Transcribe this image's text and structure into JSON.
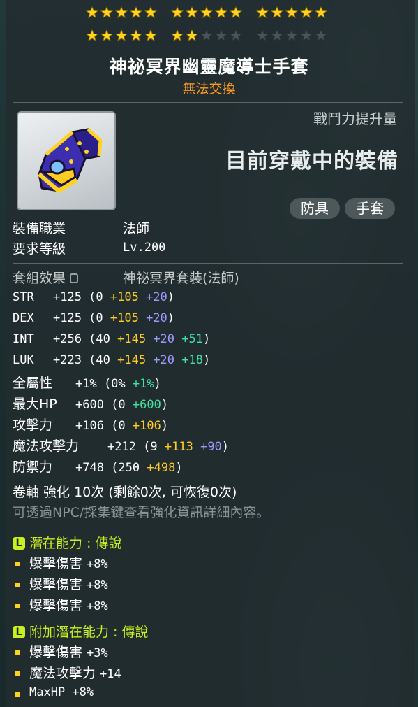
{
  "stars": {
    "row1": [
      5,
      5,
      5
    ],
    "row2": [
      5,
      2,
      0
    ],
    "filled_color": "#ffd21e",
    "empty_color": "#4a5355"
  },
  "item": {
    "name": "神祕冥界幽靈魔導士手套",
    "trade": "無法交換"
  },
  "compare": {
    "fight_label": "戰鬥力提升量",
    "wearing": "目前穿戴中的裝備",
    "tags": [
      "防具",
      "手套"
    ]
  },
  "req": {
    "job_label": "裝備職業",
    "job_value": "法師",
    "level_label": "要求等級",
    "level_value": "Lv.200"
  },
  "set": {
    "label": "套組效果",
    "value": "神祕冥界套裝(法師)"
  },
  "stats": [
    {
      "name": "STR",
      "total": "+125",
      "open": "(0",
      "parts": [
        {
          "t": "+105",
          "c": "yellow"
        },
        {
          "t": "+20",
          "c": "blue"
        }
      ],
      "close": ")",
      "mono": true
    },
    {
      "name": "DEX",
      "total": "+125",
      "open": "(0",
      "parts": [
        {
          "t": "+105",
          "c": "yellow"
        },
        {
          "t": "+20",
          "c": "blue"
        }
      ],
      "close": ")",
      "mono": true
    },
    {
      "name": "INT",
      "total": "+256",
      "open": "(40",
      "parts": [
        {
          "t": "+145",
          "c": "yellow"
        },
        {
          "t": "+20",
          "c": "blue"
        },
        {
          "t": "+51",
          "c": "green"
        }
      ],
      "close": ")",
      "mono": true
    },
    {
      "name": "LUK",
      "total": "+223",
      "open": "(40",
      "parts": [
        {
          "t": "+145",
          "c": "yellow"
        },
        {
          "t": "+20",
          "c": "blue"
        },
        {
          "t": "+18",
          "c": "green"
        }
      ],
      "close": ")",
      "mono": true
    },
    {
      "name": "全屬性",
      "total": "+1%",
      "open": "(0%",
      "parts": [
        {
          "t": "+1%",
          "c": "green"
        }
      ],
      "close": ")",
      "mono": false
    },
    {
      "name": "最大HP",
      "total": "+600",
      "open": "(0",
      "parts": [
        {
          "t": "+600",
          "c": "green"
        }
      ],
      "close": ")",
      "mono": false
    },
    {
      "name": "攻擊力",
      "total": "+106",
      "open": "(0",
      "parts": [
        {
          "t": "+106",
          "c": "yellow"
        }
      ],
      "close": ")",
      "mono": false
    },
    {
      "name": "魔法攻擊力",
      "total": "+212",
      "open": "(9",
      "parts": [
        {
          "t": "+113",
          "c": "yellow"
        },
        {
          "t": "+90",
          "c": "blue"
        }
      ],
      "close": ")",
      "mono": false
    },
    {
      "name": "防禦力",
      "total": "+748",
      "open": "(250",
      "parts": [
        {
          "t": "+498",
          "c": "yellow"
        }
      ],
      "close": ")",
      "mono": false
    }
  ],
  "scroll": {
    "line": "卷軸 強化 10次 (剩餘0次, 可恢復0次)",
    "hint": "可透過NPC/採集鍵查看強化資訊詳細內容。"
  },
  "potential": {
    "badge": "L",
    "title": "潛在能力 : 傳說",
    "lines": [
      {
        "name": "爆擊傷害",
        "val": "+8%"
      },
      {
        "name": "爆擊傷害",
        "val": "+8%"
      },
      {
        "name": "爆擊傷害",
        "val": "+8%"
      }
    ]
  },
  "bonus": {
    "badge": "L",
    "title": "附加潛在能力 : 傳說",
    "lines": [
      {
        "name": "爆擊傷害",
        "val": "+3%"
      },
      {
        "name": "魔法攻擊力",
        "val": "+14"
      },
      {
        "name": "MaxHP",
        "val": "+8%"
      }
    ]
  }
}
